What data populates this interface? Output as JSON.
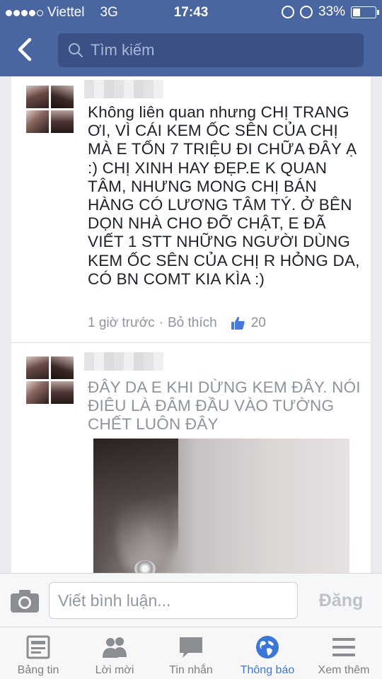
{
  "status_bar": {
    "carrier": "Viettel",
    "network": "3G",
    "time": "17:43",
    "battery_text": "33%",
    "battery_level": 0.33
  },
  "nav": {
    "back_icon": "chevron-left-icon",
    "search_placeholder": "Tìm kiếm"
  },
  "comments": [
    {
      "text": "Không liên quan nhưng CHỊ TRANG ƠI, VÌ CÁI KEM ỐC SÊN CỦA CHỊ MÀ E TỐN 7 TRIỆU ĐI CHỮA ĐÂY Ạ :) CHỊ XINH HAY ĐẸP.E K QUAN TÂM, NHƯNG MONG CHỊ BÁN HÀNG CÓ LƯƠNG TÂM TÝ. Ở BÊN DỌN NHÀ CHO ĐỠ CHẬT, E ĐÃ VIẾT 1 STT NHỮNG NGƯỜI DÙNG KEM ỐC SÊN CỦA CHỊ R HỎNG DA, CÓ BN COMT KIA KÌA :)",
      "time": "1 giờ trước",
      "separator": "·",
      "unlike_label": "Bỏ thích",
      "like_count": "20"
    },
    {
      "text": "ĐÂY DA E KHI DỪNG KEM ĐÂY. NÓI ĐIÊU LÀ ĐÂM ĐẦU VÀO TƯỜNG CHẾT LUÔN ĐÂY"
    }
  ],
  "composer": {
    "camera_icon": "camera-icon",
    "placeholder": "Viết bình luận...",
    "post_label": "Đăng"
  },
  "tabs": [
    {
      "label": "Bảng tin",
      "icon": "news-feed-icon"
    },
    {
      "label": "Lời mời",
      "icon": "friend-requests-icon"
    },
    {
      "label": "Tin nhắn",
      "icon": "messages-icon"
    },
    {
      "label": "Thông báo",
      "icon": "globe-icon",
      "active": true
    },
    {
      "label": "Xem thêm",
      "icon": "menu-icon"
    }
  ],
  "colors": {
    "header": "#4a66a0",
    "search_bg": "#3b5186",
    "active_tab": "#3b77d8",
    "like_blue": "#4a7ad8"
  }
}
